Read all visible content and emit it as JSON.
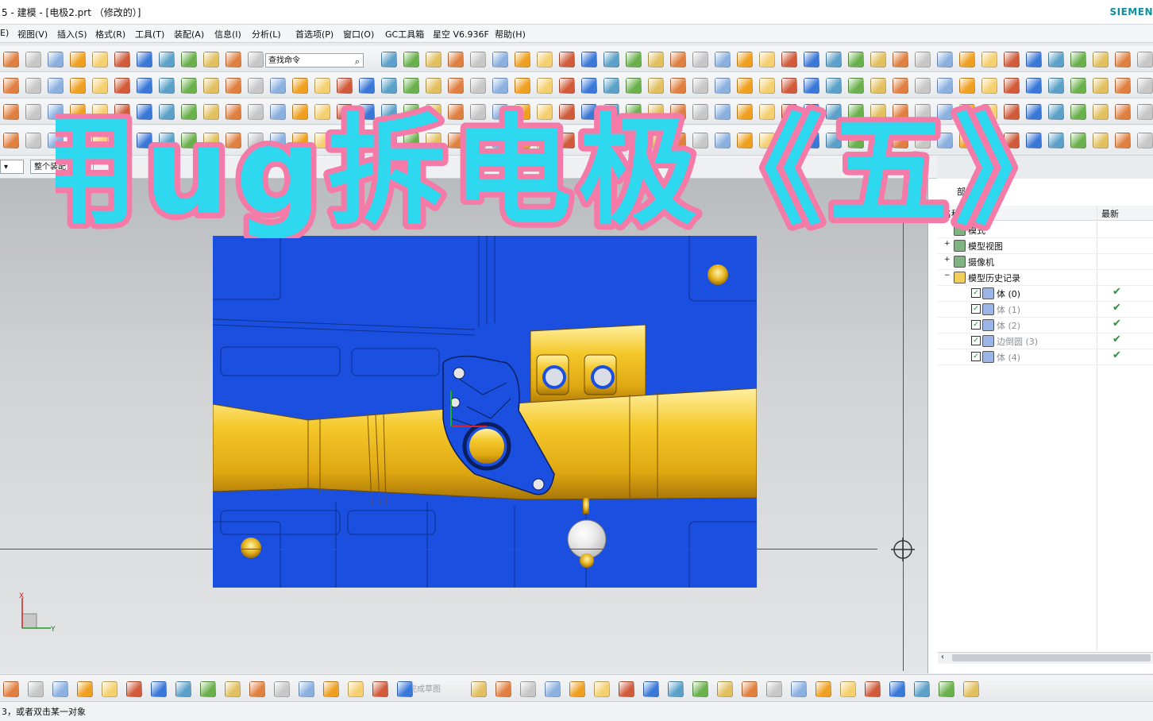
{
  "window": {
    "title": "5 - 建模 - [电极2.prt （修改的）]",
    "brand": "SIEMEN"
  },
  "menu": [
    "E)",
    "视图(V)",
    "插入(S)",
    "格式(R)",
    "工具(T)",
    "装配(A)",
    "信息(I)",
    "分析(L)",
    "首选项(P)",
    "窗口(O)",
    "GC工具箱",
    "星空 V6.936F",
    "帮助(H)"
  ],
  "toolbar": {
    "search_placeholder": "查找命令"
  },
  "selection": {
    "filter_value": "整个装配"
  },
  "overlay": {
    "text": "用ug拆电极《五》"
  },
  "navigator": {
    "header_partial": "部件",
    "col_name_partial": "名称",
    "col_latest": "最新",
    "rows": [
      {
        "label": "模式",
        "indent": 0
      },
      {
        "label": "模型视图",
        "indent": 0
      },
      {
        "label": "摄像机",
        "indent": 0
      },
      {
        "label": "模型历史记录",
        "indent": 0
      },
      {
        "label": "体 (0)",
        "indent": 1,
        "latest": "✔"
      },
      {
        "label": "体 (1)",
        "indent": 1,
        "latest": "✔"
      },
      {
        "label": "体 (2)",
        "indent": 1,
        "latest": "✔"
      },
      {
        "label": "边倒圆 (3)",
        "indent": 1,
        "latest": "✔"
      },
      {
        "label": "体 (4)",
        "indent": 1,
        "latest": "✔"
      }
    ]
  },
  "bottom_toolbar": {
    "finish_sketch": "完成草图"
  },
  "status": {
    "prompt": "3，或者双击某一对象"
  },
  "triad": {
    "x": "X",
    "y": "Y"
  },
  "colors": {
    "mold_blue": "#1a4fe0",
    "part_gold": "#f2c21f",
    "overlay_fill": "#2ed9f0",
    "overlay_stroke": "#f47aa8"
  }
}
